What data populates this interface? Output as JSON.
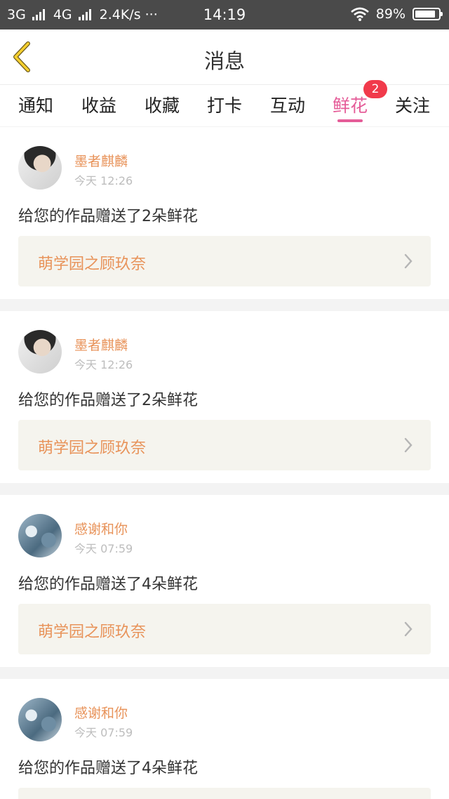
{
  "status_bar": {
    "network1": "3G",
    "network2": "4G",
    "speed": "2.4K/s",
    "dots": "···",
    "time": "14:19",
    "battery_percent": "89%",
    "battery_level": 0.89
  },
  "header": {
    "title": "消息"
  },
  "tabs": [
    {
      "label": "通知"
    },
    {
      "label": "收益"
    },
    {
      "label": "收藏"
    },
    {
      "label": "打卡"
    },
    {
      "label": "互动"
    },
    {
      "label": "鲜花",
      "active": true,
      "badge": "2"
    },
    {
      "label": "关注"
    }
  ],
  "messages": [
    {
      "name": "墨者麒麟",
      "time": "今天 12:26",
      "text": "给您的作品赠送了2朵鲜花",
      "work": "萌学园之顾玖奈"
    },
    {
      "name": "墨者麒麟",
      "time": "今天 12:26",
      "text": "给您的作品赠送了2朵鲜花",
      "work": "萌学园之顾玖奈"
    },
    {
      "name": "感谢和你",
      "time": "今天 07:59",
      "text": "给您的作品赠送了4朵鲜花",
      "work": "萌学园之顾玖奈"
    },
    {
      "name": "感谢和你",
      "time": "今天 07:59",
      "text": "给您的作品赠送了4朵鲜花"
    }
  ],
  "colors": {
    "accent": "#e55c98",
    "name": "#e8935a",
    "badge": "#f13a4b"
  }
}
